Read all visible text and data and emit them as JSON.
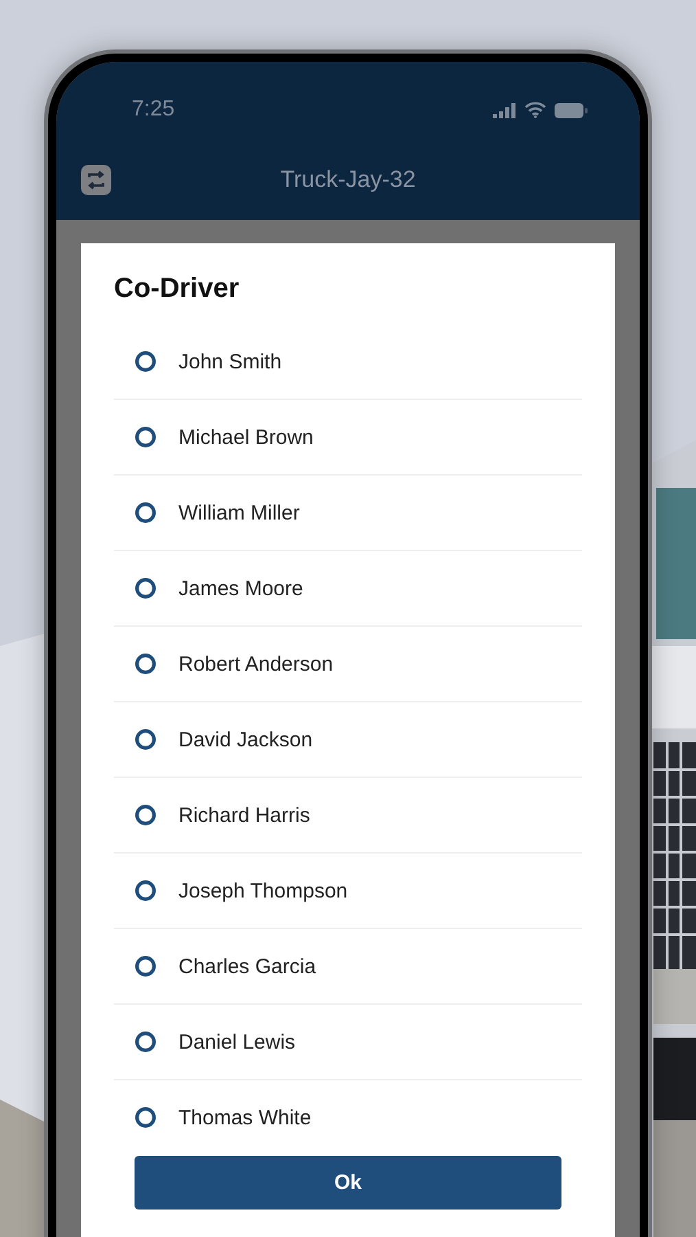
{
  "status_bar": {
    "time": "7:25"
  },
  "app_bar": {
    "title": "Truck-Jay-32"
  },
  "dialog": {
    "title": "Co-Driver",
    "options": [
      {
        "label": "John Smith",
        "selected": false
      },
      {
        "label": "Michael Brown",
        "selected": false
      },
      {
        "label": "William Miller",
        "selected": false
      },
      {
        "label": "James Moore",
        "selected": false
      },
      {
        "label": "Robert Anderson",
        "selected": false
      },
      {
        "label": "David Jackson",
        "selected": false
      },
      {
        "label": "Richard Harris",
        "selected": false
      },
      {
        "label": "Joseph Thompson",
        "selected": false
      },
      {
        "label": "Charles Garcia",
        "selected": false
      },
      {
        "label": "Daniel Lewis",
        "selected": false
      },
      {
        "label": "Thomas White",
        "selected": false
      }
    ],
    "button": "Ok"
  }
}
